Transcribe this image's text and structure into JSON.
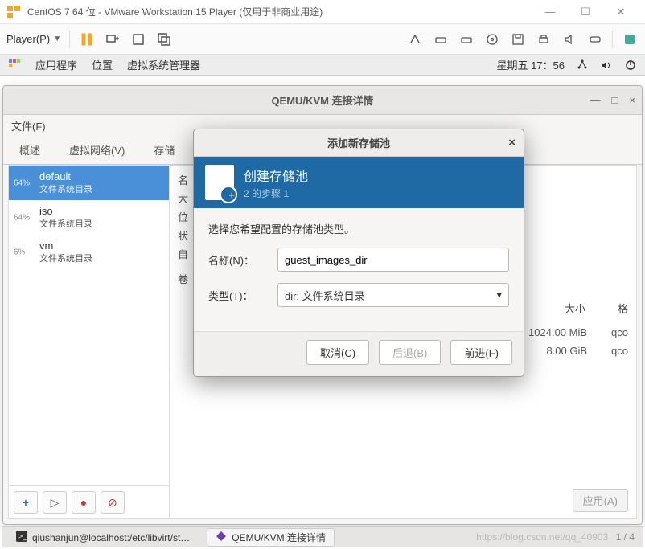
{
  "vmware": {
    "title": "CentOS 7 64 位 - VMware Workstation 15 Player (仅用于非商业用途)",
    "player_label": "Player(P)"
  },
  "gnome": {
    "apps": "应用程序",
    "places": "位置",
    "vm_mgr": "虚拟系统管理器",
    "clock": "星期五 17：56"
  },
  "qemu": {
    "title": "QEMU/KVM 连接详情",
    "file_menu": "文件(F)",
    "tabs": {
      "overview": "概述",
      "vnet": "虚拟网络(V)",
      "storage": "存储"
    },
    "pools": [
      {
        "pct": "64%",
        "name": "default",
        "sub": "文件系统目录"
      },
      {
        "pct": "64%",
        "name": "iso",
        "sub": "文件系统目录"
      },
      {
        "pct": "6%",
        "name": "vm",
        "sub": "文件系统目录"
      }
    ],
    "labels": {
      "name": "名",
      "big": "大",
      "pos": "位",
      "state": "状",
      "auto": "自",
      "vol": "卷"
    },
    "table": {
      "col_size": "大小",
      "col_fmt": "格",
      "row1": {
        "size": "1024.00 MiB",
        "fmt": "qco"
      },
      "row2": {
        "size": "8.00 GiB",
        "fmt": "qco"
      }
    },
    "apply": "应用(A)"
  },
  "modal": {
    "title": "添加新存储池",
    "heading": "创建存储池",
    "step": "2 的步骤 1",
    "hint": "选择您希望配置的存储池类型。",
    "name_label": "名称(N)：",
    "name_value": "guest_images_dir",
    "type_label": "类型(T)：",
    "type_value": "dir: 文件系统目录",
    "cancel": "取消(C)",
    "back": "后退(B)",
    "forward": "前进(F)"
  },
  "taskbar": {
    "terminal": "qiushanjun@localhost:/etc/libvirt/st…",
    "qemu": "QEMU/KVM 连接详情",
    "page": "1 / 4"
  },
  "watermark": "https://blog.csdn.net/qq_40903"
}
